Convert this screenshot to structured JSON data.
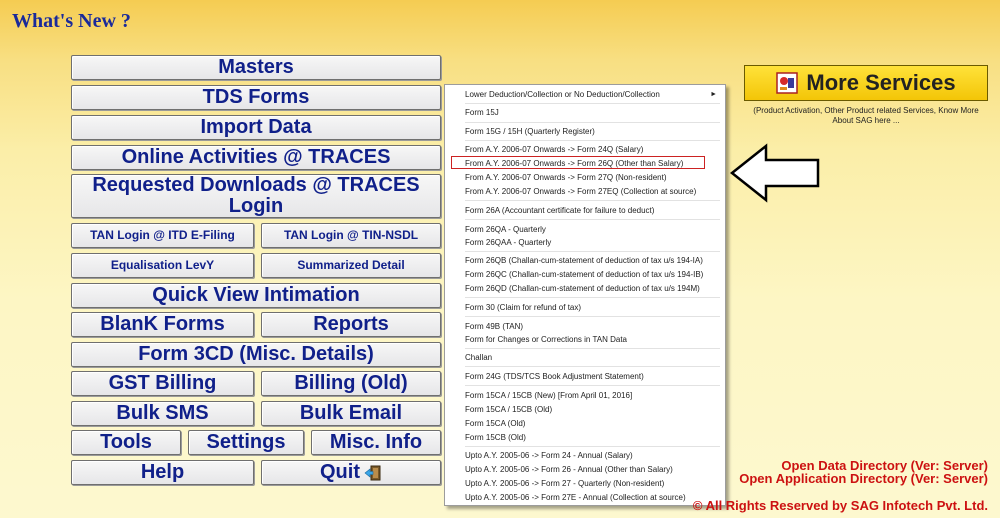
{
  "header": {
    "title": "What's New ?"
  },
  "buttons": {
    "masters": "Masters",
    "tds_forms": "TDS Forms",
    "import_data": "Import Data",
    "online_activities": "Online Activities @ TRACES",
    "requested_downloads_line1": "Requested Downloads @ TRACES",
    "requested_downloads_line2": "Login",
    "tan_login_itd": "TAN Login @ ITD E-Filing",
    "tan_login_nsdl": "TAN Login @ TIN-NSDL",
    "equalisation_levy": "Equalisation LevY",
    "summarized_detail": "Summarized Detail",
    "quick_view_intimation": "Quick View Intimation",
    "blank_forms": "BlanK Forms",
    "reports": "Reports",
    "form_3cd": "Form 3CD (Misc. Details)",
    "gst_billing": "GST Billing",
    "billing_old": "Billing (Old)",
    "bulk_sms": "Bulk SMS",
    "bulk_email": "Bulk Email",
    "tools": "Tools",
    "settings": "Settings",
    "misc_info": "Misc. Info",
    "help": "Help",
    "quit": "Quit"
  },
  "menu": {
    "items": [
      "Lower Deduction/Collection or No Deduction/Collection",
      "Form 15J",
      "Form 15G / 15H (Quarterly Register)",
      "From A.Y. 2006-07 Onwards -> Form 24Q (Salary)",
      "From A.Y. 2006-07 Onwards -> Form 26Q (Other than Salary)",
      "From A.Y. 2006-07 Onwards -> Form 27Q (Non-resident)",
      "From A.Y. 2006-07 Onwards -> Form 27EQ (Collection at source)",
      "Form 26A (Accountant certificate for failure to deduct)",
      "Form 26QA - Quarterly",
      "Form 26QAA - Quarterly",
      "Form 26QB (Challan-cum-statement of deduction of tax u/s 194-IA)",
      "Form 26QC (Challan-cum-statement of deduction of tax u/s 194-IB)",
      "Form 26QD (Challan-cum-statement of deduction of tax u/s 194M)",
      "Form 30 (Claim for refund of tax)",
      "Form 49B (TAN)",
      "Form for Changes or Corrections in TAN Data",
      "Challan",
      "Form 24G (TDS/TCS Book Adjustment Statement)",
      "Form 15CA / 15CB (New) [From April 01, 2016]",
      "Form 15CA / 15CB (Old)",
      "Form 15CA (Old)",
      "Form 15CB (Old)",
      "Upto A.Y. 2005-06 -> Form 24 - Annual (Salary)",
      "Upto A.Y. 2005-06 -> Form 26 - Annual (Other than Salary)",
      "Upto A.Y. 2005-06 -> Form 27 - Quarterly (Non-resident)",
      "Upto A.Y. 2005-06 -> Form 27E - Annual (Collection at source)"
    ],
    "highlighted_index": 4,
    "submenu_arrow": "►"
  },
  "more_services": {
    "label": "More Services",
    "description": "(Product Activation, Other Product related Services, Know More About SAG here ..."
  },
  "footer": {
    "open_data_dir": "Open Data Directory (Ver: Server)",
    "open_app_dir": "Open Application Directory (Ver: Server)",
    "rights": "© All Rights Reserved by SAG Infotech Pvt. Ltd."
  },
  "colors": {
    "button_text": "#10208a",
    "title": "#1a2a9a",
    "footer_red": "#cc1111",
    "highlight_box": "#cc2222",
    "more_services_bg": "#f3c507"
  },
  "icons": [
    "quit-door-icon",
    "more-services-logo-icon",
    "left-arrow-icon",
    "submenu-arrow-icon"
  ]
}
